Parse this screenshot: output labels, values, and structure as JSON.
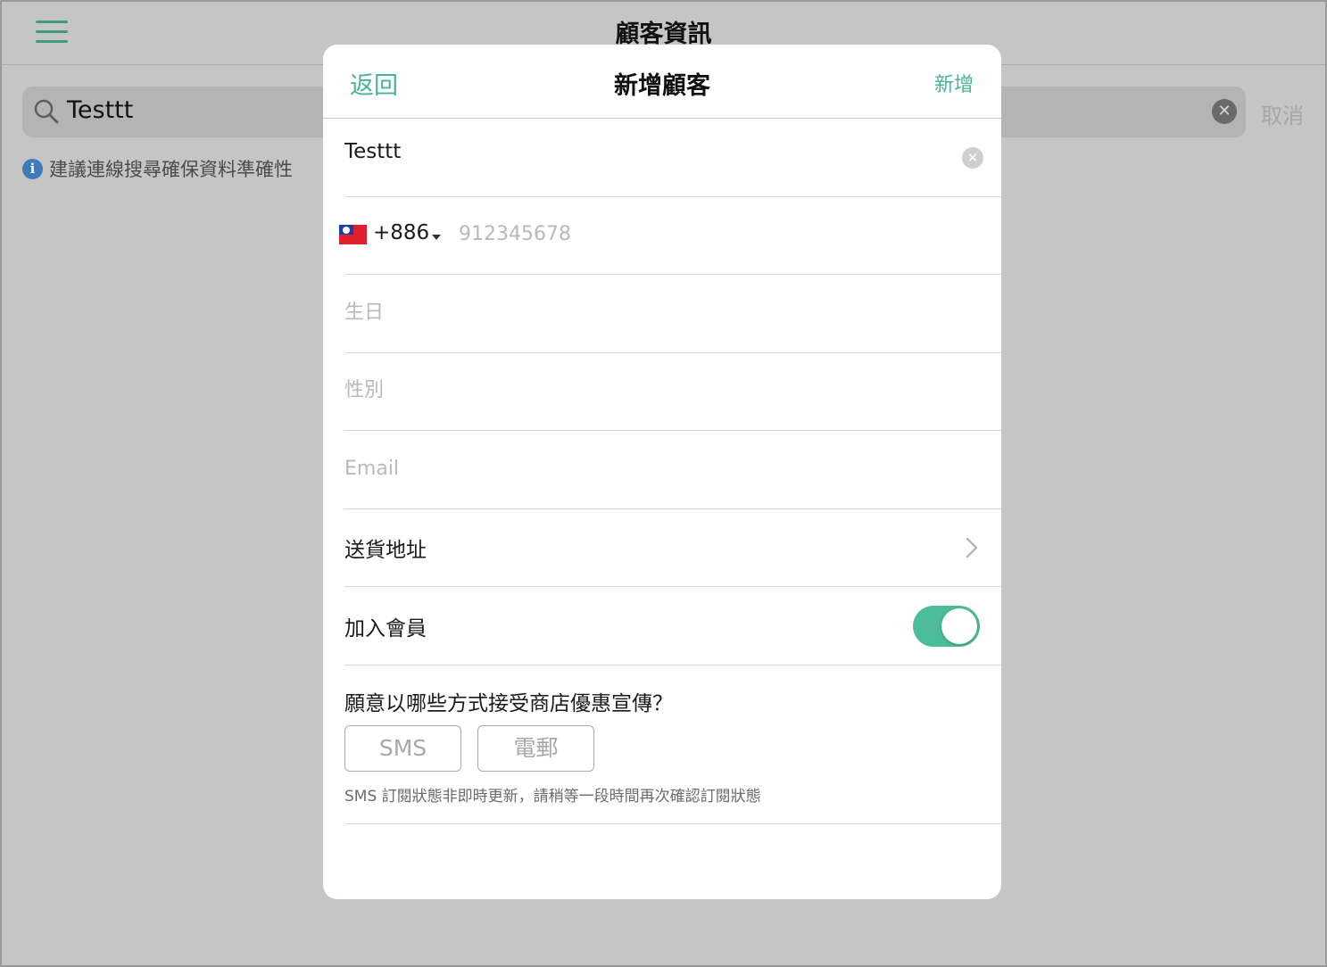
{
  "background": {
    "title": "顧客資訊",
    "search": {
      "query": "Testtt",
      "cancel_label": "取消"
    },
    "hint": "建議連線搜尋確保資料準確性"
  },
  "modal": {
    "back_label": "返回",
    "title": "新增顧客",
    "add_label": "新增",
    "name_value": "Testtt",
    "country_code": "+886",
    "phone_placeholder": "912345678",
    "birthday_placeholder": "生日",
    "gender_placeholder": "性別",
    "email_placeholder": "Email",
    "address_label": "送貨地址",
    "membership_label": "加入會員",
    "membership_enabled": true,
    "promo_question": "願意以哪些方式接受商店優惠宣傳？",
    "promo_options": [
      "SMS",
      "電郵"
    ],
    "promo_note": "SMS 訂閱狀態非即時更新，請稍等一段時間再次確認訂閱狀態"
  },
  "colors": {
    "accent": "#46b597",
    "toggle_on": "#4cbb98",
    "overlay_bg": "#c4c5c4"
  },
  "icons": [
    "menu-icon",
    "search-icon",
    "clear-icon",
    "info-icon",
    "taiwan-flag-icon",
    "caret-down-icon",
    "chevron-right-icon"
  ]
}
